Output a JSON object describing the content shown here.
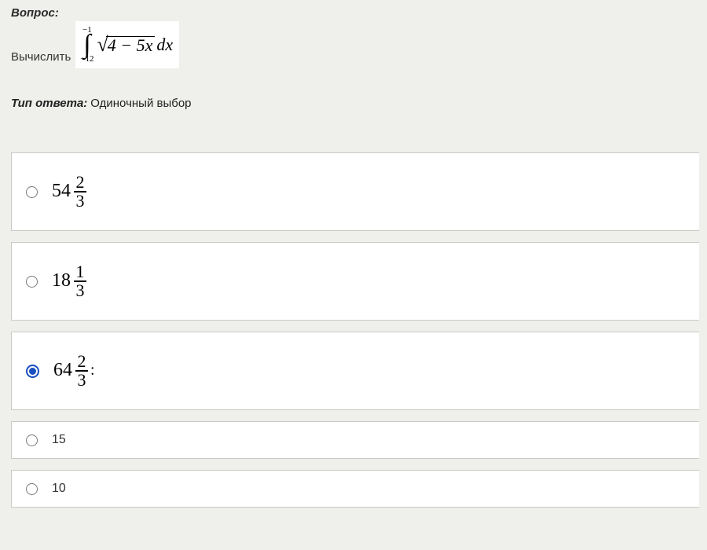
{
  "question": {
    "label": "Вопрос:",
    "compute_word": "Вычислить",
    "integral": {
      "upper": "−1",
      "lower": "−12",
      "radicand": "4 − 5x",
      "differential": "dx"
    }
  },
  "answer_type": {
    "label": "Тип ответа:",
    "value": "Одиночный выбор"
  },
  "options": [
    {
      "kind": "mixed",
      "whole": "54",
      "num": "2",
      "den": "3",
      "selected": false
    },
    {
      "kind": "mixed",
      "whole": "18",
      "num": "1",
      "den": "3",
      "selected": false
    },
    {
      "kind": "mixed",
      "whole": "64",
      "num": "2",
      "den": "3",
      "selected": true,
      "trail": ":"
    },
    {
      "kind": "plain",
      "text": "15",
      "selected": false
    },
    {
      "kind": "plain",
      "text": "10",
      "selected": false
    }
  ]
}
